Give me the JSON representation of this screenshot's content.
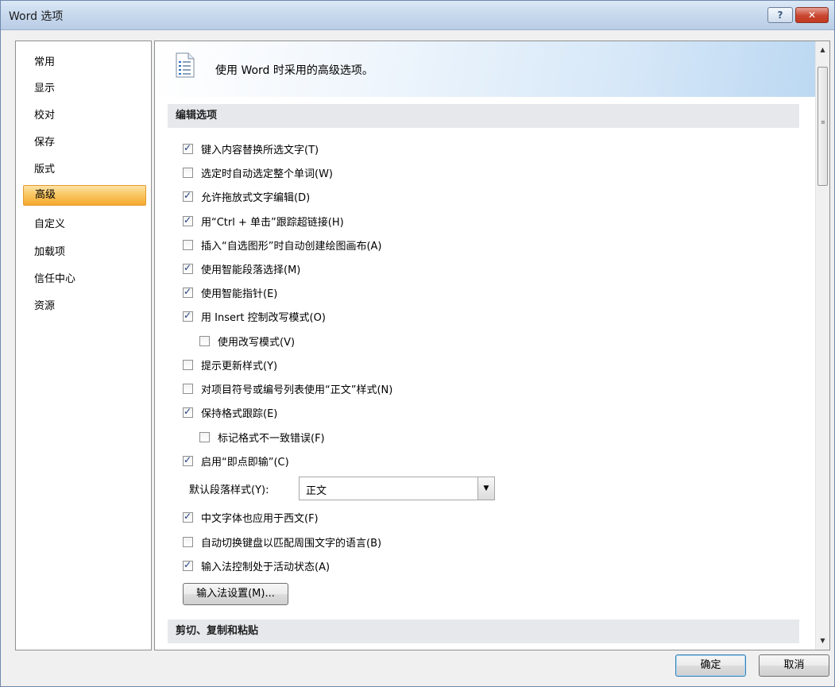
{
  "window": {
    "title": "Word 选项",
    "help_label": "?",
    "close_label": "✕"
  },
  "nav": {
    "items": [
      {
        "label": "常用"
      },
      {
        "label": "显示"
      },
      {
        "label": "校对"
      },
      {
        "label": "保存"
      },
      {
        "label": "版式"
      },
      {
        "label": "高级",
        "selected": true
      },
      {
        "label": "自定义"
      },
      {
        "label": "加载项"
      },
      {
        "label": "信任中心"
      },
      {
        "label": "资源"
      }
    ]
  },
  "header": {
    "text": "使用 Word 时采用的高级选项。"
  },
  "sections": {
    "editing": "编辑选项",
    "clipboard": "剪切、复制和粘贴"
  },
  "options": [
    {
      "label": "键入内容替换所选文字(T)",
      "checked": true
    },
    {
      "label": "选定时自动选定整个单词(W)",
      "checked": false
    },
    {
      "label": "允许拖放式文字编辑(D)",
      "checked": true
    },
    {
      "label": "用“Ctrl + 单击”跟踪超链接(H)",
      "checked": true
    },
    {
      "label": "插入“自选图形”时自动创建绘图画布(A)",
      "checked": false
    },
    {
      "label": "使用智能段落选择(M)",
      "checked": true
    },
    {
      "label": "使用智能指针(E)",
      "checked": true
    },
    {
      "label": "用 Insert 控制改写模式(O)",
      "checked": true
    },
    {
      "label": "使用改写模式(V)",
      "checked": false
    },
    {
      "label": "提示更新样式(Y)",
      "checked": false
    },
    {
      "label": "对项目符号或编号列表使用“正文”样式(N)",
      "checked": false
    },
    {
      "label": "保持格式跟踪(E)",
      "checked": true
    },
    {
      "label": "标记格式不一致错误(F)",
      "checked": false
    },
    {
      "label": "启用“即点即输”(C)",
      "checked": true
    },
    {
      "label": "中文字体也应用于西文(F)",
      "checked": true
    },
    {
      "label": "自动切换键盘以匹配周围文字的语言(B)",
      "checked": false
    },
    {
      "label": "输入法控制处于活动状态(A)",
      "checked": true
    }
  ],
  "default_style": {
    "label": "默认段落样式(Y):",
    "value": "正文"
  },
  "ime_button": "输入法设置(M)...",
  "footer": {
    "ok": "确定",
    "cancel": "取消"
  }
}
